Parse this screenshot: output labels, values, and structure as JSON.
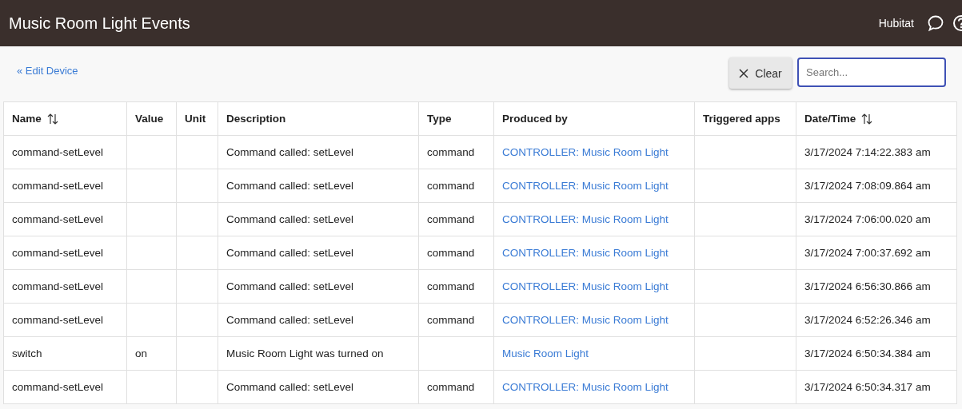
{
  "header": {
    "title": "Music Room Light Events",
    "hub_name": "Hubitat"
  },
  "back_link": "« Edit Device",
  "clear_button": "Clear",
  "search": {
    "placeholder": "Search..."
  },
  "table": {
    "columns": [
      {
        "label": "Name",
        "sortable": true
      },
      {
        "label": "Value",
        "sortable": false
      },
      {
        "label": "Unit",
        "sortable": false
      },
      {
        "label": "Description",
        "sortable": false
      },
      {
        "label": "Type",
        "sortable": false
      },
      {
        "label": "Produced by",
        "sortable": false
      },
      {
        "label": "Triggered apps",
        "sortable": false
      },
      {
        "label": "Date/Time",
        "sortable": true
      }
    ],
    "rows": [
      {
        "name": "command-setLevel",
        "value": "",
        "unit": "",
        "description": "Command called: setLevel",
        "type": "command",
        "produced_by": "CONTROLLER: Music Room Light",
        "triggered_apps": "",
        "date_time": "3/17/2024 7:14:22.383 am"
      },
      {
        "name": "command-setLevel",
        "value": "",
        "unit": "",
        "description": "Command called: setLevel",
        "type": "command",
        "produced_by": "CONTROLLER: Music Room Light",
        "triggered_apps": "",
        "date_time": "3/17/2024 7:08:09.864 am"
      },
      {
        "name": "command-setLevel",
        "value": "",
        "unit": "",
        "description": "Command called: setLevel",
        "type": "command",
        "produced_by": "CONTROLLER: Music Room Light",
        "triggered_apps": "",
        "date_time": "3/17/2024 7:06:00.020 am"
      },
      {
        "name": "command-setLevel",
        "value": "",
        "unit": "",
        "description": "Command called: setLevel",
        "type": "command",
        "produced_by": "CONTROLLER: Music Room Light",
        "triggered_apps": "",
        "date_time": "3/17/2024 7:00:37.692 am"
      },
      {
        "name": "command-setLevel",
        "value": "",
        "unit": "",
        "description": "Command called: setLevel",
        "type": "command",
        "produced_by": "CONTROLLER: Music Room Light",
        "triggered_apps": "",
        "date_time": "3/17/2024 6:56:30.866 am"
      },
      {
        "name": "command-setLevel",
        "value": "",
        "unit": "",
        "description": "Command called: setLevel",
        "type": "command",
        "produced_by": "CONTROLLER: Music Room Light",
        "triggered_apps": "",
        "date_time": "3/17/2024 6:52:26.346 am"
      },
      {
        "name": "switch",
        "value": "on",
        "unit": "",
        "description": "Music Room Light was turned on",
        "type": "",
        "produced_by": "Music Room Light",
        "triggered_apps": "",
        "date_time": "3/17/2024 6:50:34.384 am"
      },
      {
        "name": "command-setLevel",
        "value": "",
        "unit": "",
        "description": "Command called: setLevel",
        "type": "command",
        "produced_by": "CONTROLLER: Music Room Light",
        "triggered_apps": "",
        "date_time": "3/17/2024 6:50:34.317 am"
      }
    ]
  }
}
